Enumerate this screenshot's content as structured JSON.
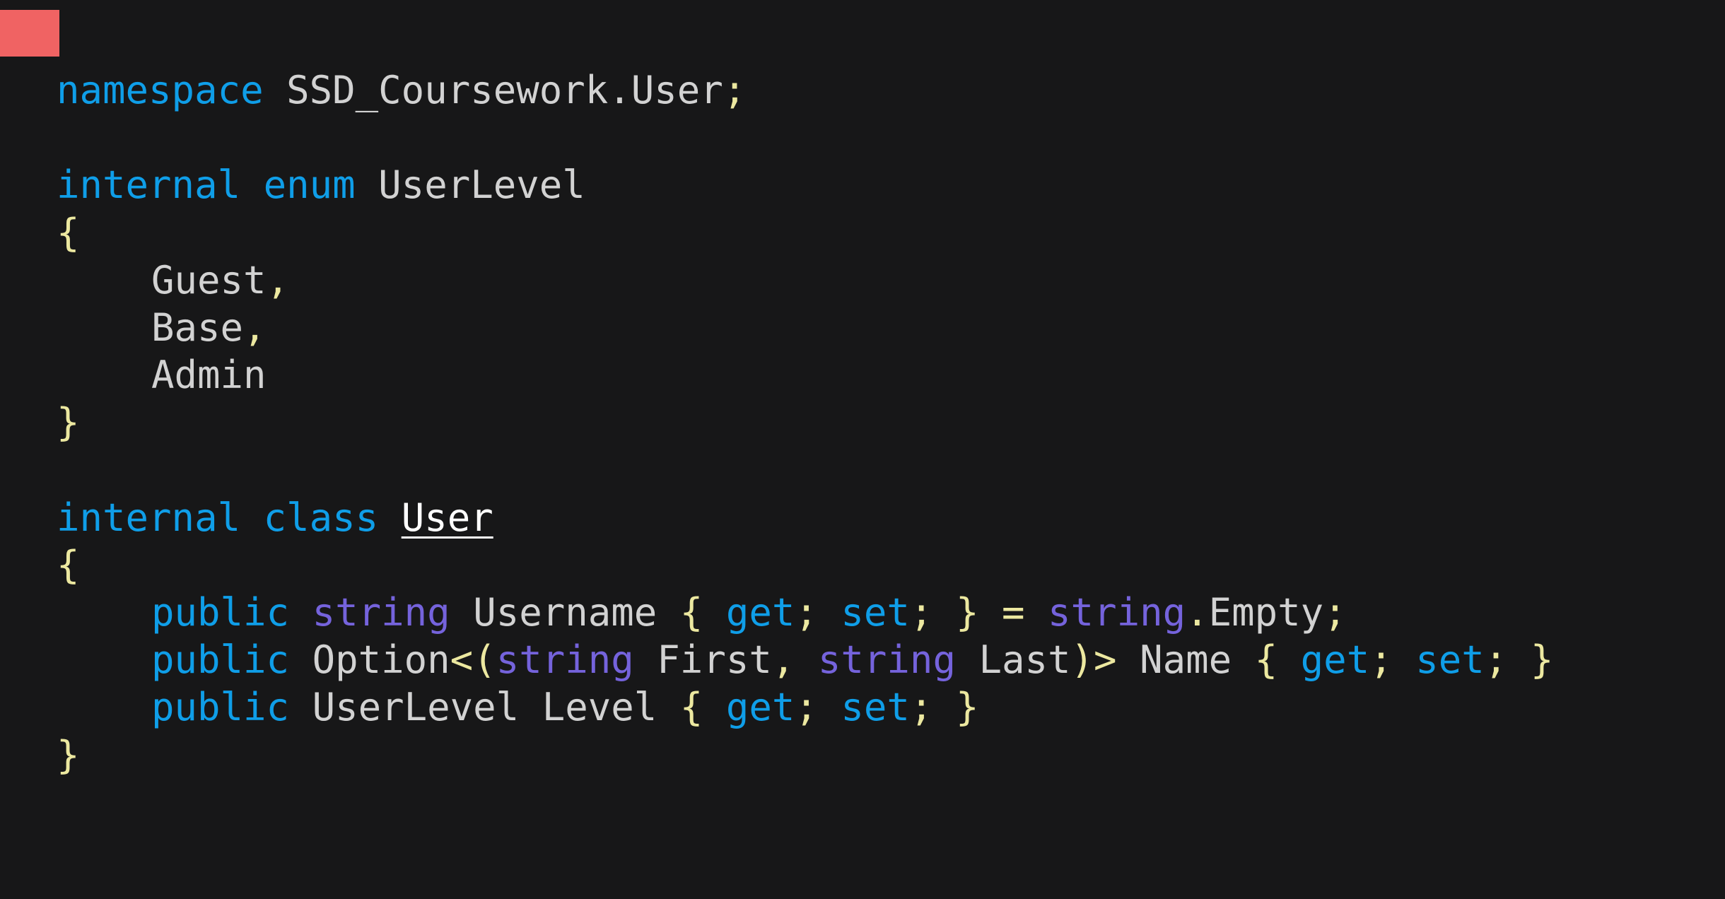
{
  "colors": {
    "background": "#171718",
    "keyword": "#0f9ee8",
    "type": "#7563dc",
    "identifier": "#d2d2d2",
    "punctuation": "#ece8a0",
    "cursor": "#f06363"
  },
  "code": {
    "ns": {
      "kw": "namespace",
      "name": "SSD_Coursework.User",
      "semi": ";"
    },
    "enum": {
      "kw1": "internal",
      "kw2": "enum",
      "name": "UserLevel",
      "open": "{",
      "close": "}",
      "members": [
        "Guest",
        "Base",
        "Admin"
      ],
      "comma": ","
    },
    "cls": {
      "kw1": "internal",
      "kw2": "class",
      "name": "User",
      "open": "{",
      "close": "}",
      "p1": {
        "pub": "public",
        "type": "string",
        "name": "Username",
        "lb": "{",
        "get": "get",
        "semi": ";",
        "set": "set",
        "rb": "}",
        "eq": "=",
        "type2": "string",
        "dot": ".",
        "member": "Empty"
      },
      "p2": {
        "pub": "public",
        "opt": "Option",
        "lt": "<",
        "lp": "(",
        "t1": "string",
        "n1": "First",
        "comma": ",",
        "t2": "string",
        "n2": "Last",
        "rp": ")",
        "gt": ">",
        "name": "Name",
        "lb": "{",
        "get": "get",
        "semi": ";",
        "set": "set",
        "rb": "}"
      },
      "p3": {
        "pub": "public",
        "type": "UserLevel",
        "name": "Level",
        "lb": "{",
        "get": "get",
        "semi": ";",
        "set": "set",
        "rb": "}"
      }
    }
  }
}
